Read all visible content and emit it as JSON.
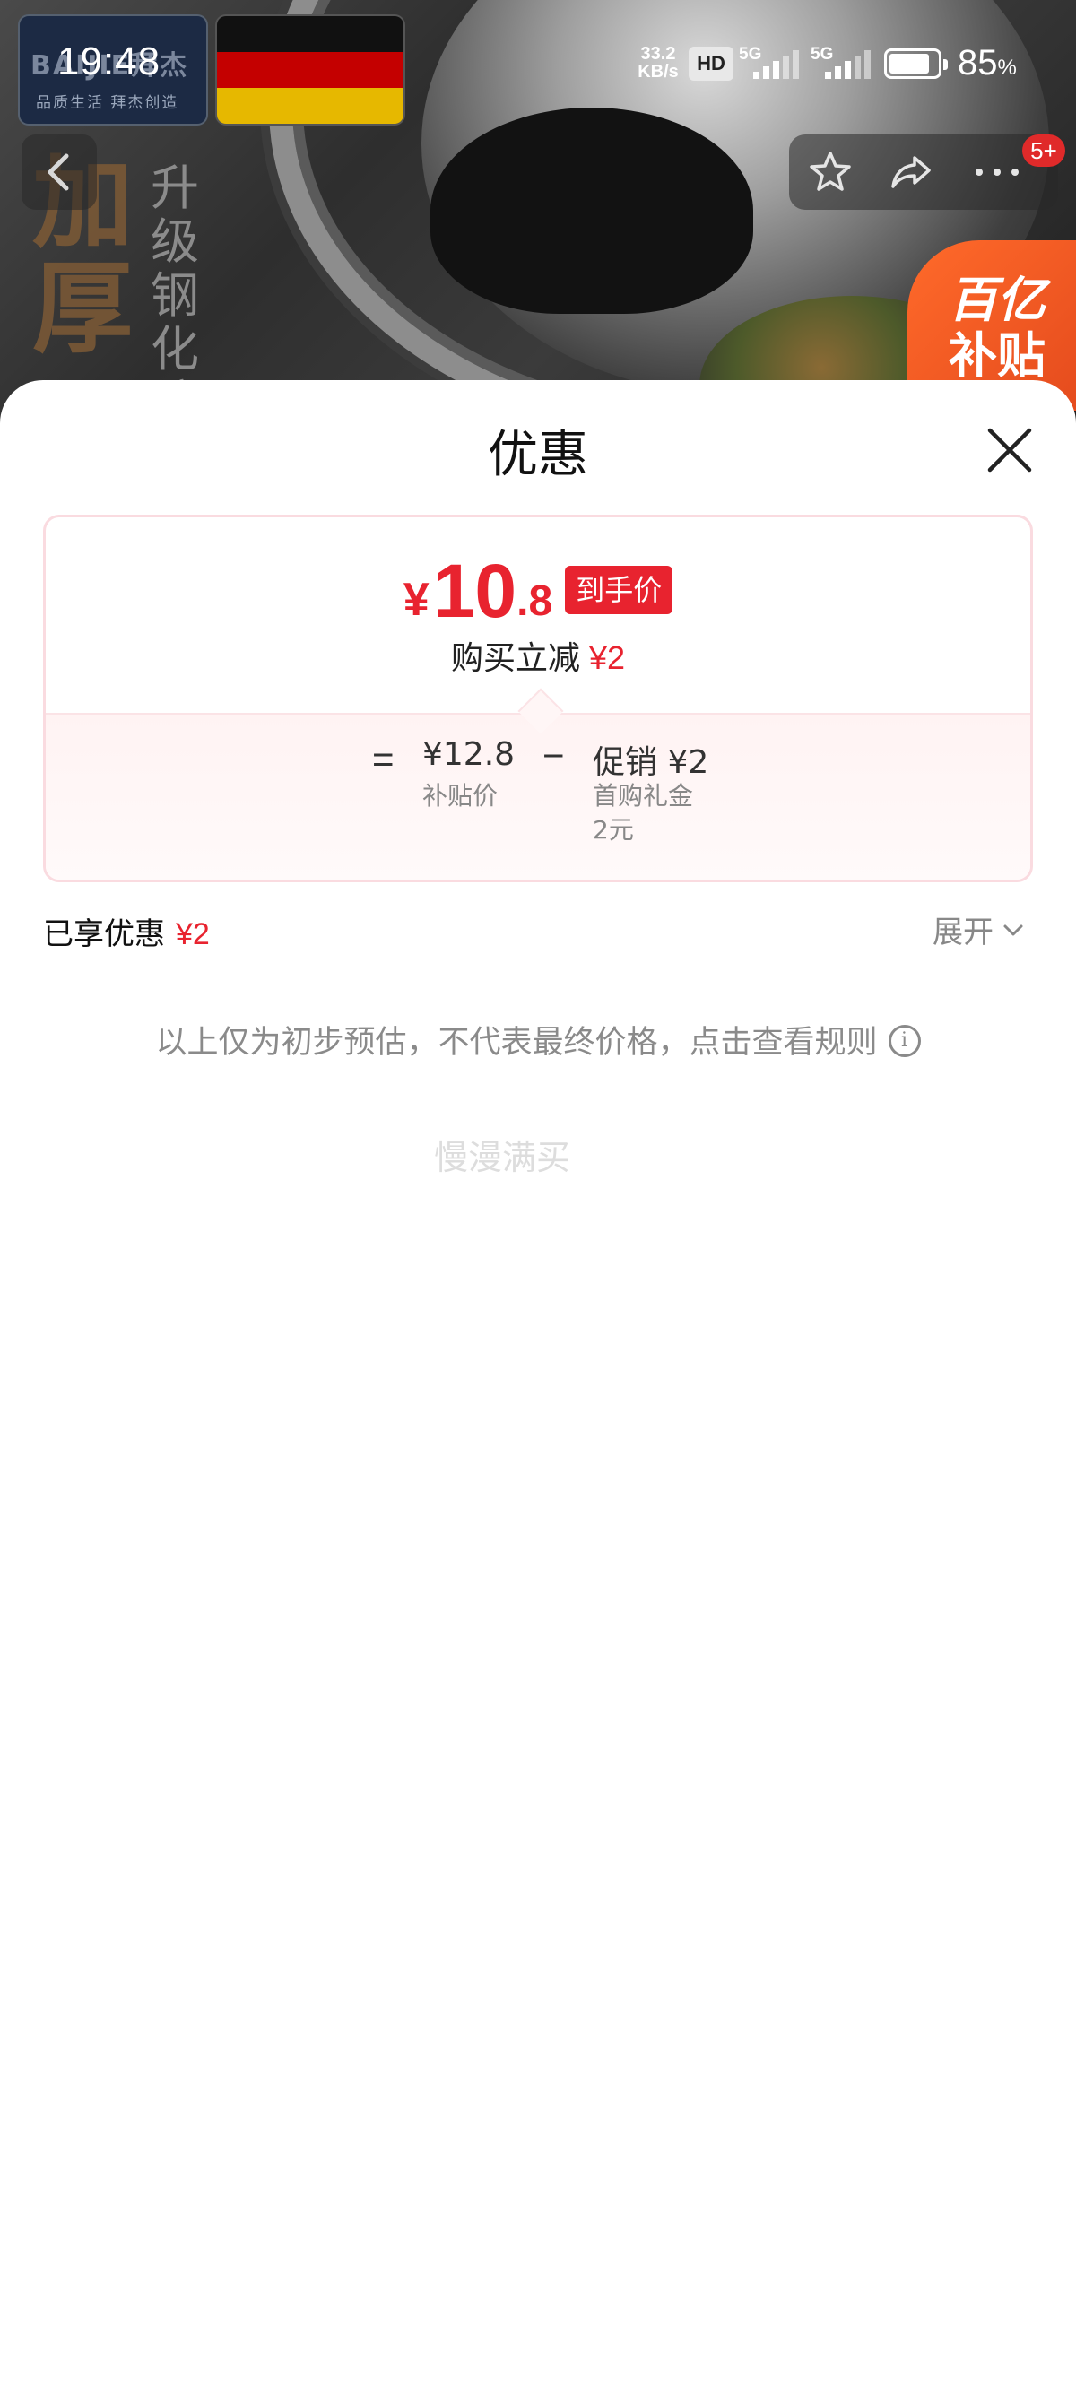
{
  "status_bar": {
    "time": "19:48",
    "net_speed_value": "33.2",
    "net_speed_unit": "KB/s",
    "hd_label": "HD",
    "signal1_label": "5G",
    "signal2_label": "5G",
    "battery_percent_value": "85",
    "battery_percent_unit": "%",
    "battery_level": 0.85
  },
  "header": {
    "brand_logo_text": "BAIJIE拜杰",
    "brand_logo_sub": "品质生活 拜杰创造",
    "slogan_big": "加厚",
    "slogan_small": "升级钢化防",
    "notification_count": "5+",
    "subsidy_line1": "百亿",
    "subsidy_line2": "补贴",
    "icons": [
      "back-icon",
      "star-icon",
      "share-icon",
      "more-icon"
    ]
  },
  "sheet": {
    "title": "优惠",
    "final_price": {
      "currency": "¥",
      "integer": "10",
      "decimal": ".8",
      "badge": "到手价"
    },
    "instant_discount": {
      "label": "购买立减",
      "amount": "¥2"
    },
    "formula": {
      "equals": "=",
      "subsidy_price": "¥12.8",
      "subsidy_price_label": "补贴价",
      "minus": "−",
      "promo_label": "促销 ¥2",
      "promo_detail_line1": "首购礼金",
      "promo_detail_line2": "2元"
    },
    "enjoyed": {
      "label": "已享优惠",
      "amount": "¥2"
    },
    "expand_label": "展开",
    "disclaimer": "以上仅为初步预估，不代表最终价格，点击查看规则",
    "ghost_text": "慢漫满买"
  },
  "colors": {
    "accent_red": "#e8232f",
    "subsidy_orange": "#f05a22",
    "card_border": "#fadbe0"
  }
}
